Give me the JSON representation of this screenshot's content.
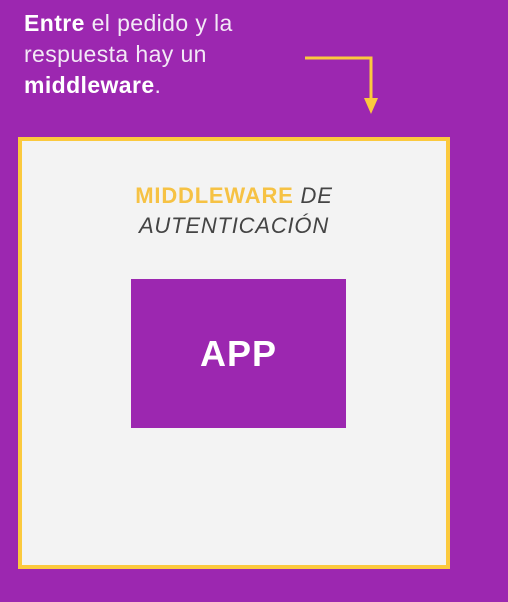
{
  "caption": {
    "part1_bold": "Entre",
    "part2": " el pedido y la respuesta hay un ",
    "part3_bold": "middleware",
    "part4": "."
  },
  "diagram": {
    "middleware_highlight": "MIDDLEWARE",
    "middleware_rest_line1": "DE",
    "middleware_rest_line2": "AUTENTICACIÓN",
    "app_label": "APP"
  },
  "colors": {
    "background": "#9c27b0",
    "accent_yellow": "#fbc93d",
    "box_fill": "#f3f3f3",
    "app_fill": "#9c27b0"
  },
  "icons": {
    "arrow": "arrow-down-icon"
  }
}
